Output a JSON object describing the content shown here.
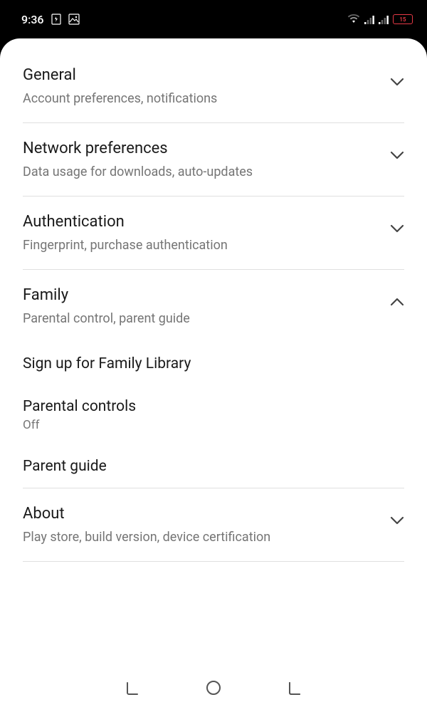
{
  "statusBar": {
    "time": "9:36",
    "batteryLevel": "15"
  },
  "sections": {
    "general": {
      "title": "General",
      "subtitle": "Account preferences, notifications"
    },
    "network": {
      "title": "Network preferences",
      "subtitle": "Data usage for downloads, auto-updates"
    },
    "authentication": {
      "title": "Authentication",
      "subtitle": "Fingerprint, purchase authentication"
    },
    "family": {
      "title": "Family",
      "subtitle": "Parental control, parent guide",
      "subItems": {
        "signup": "Sign up for Family Library",
        "parentalControls": {
          "title": "Parental controls",
          "status": "Off"
        },
        "parentGuide": "Parent guide"
      }
    },
    "about": {
      "title": "About",
      "subtitle": "Play store, build version, device certification"
    }
  }
}
